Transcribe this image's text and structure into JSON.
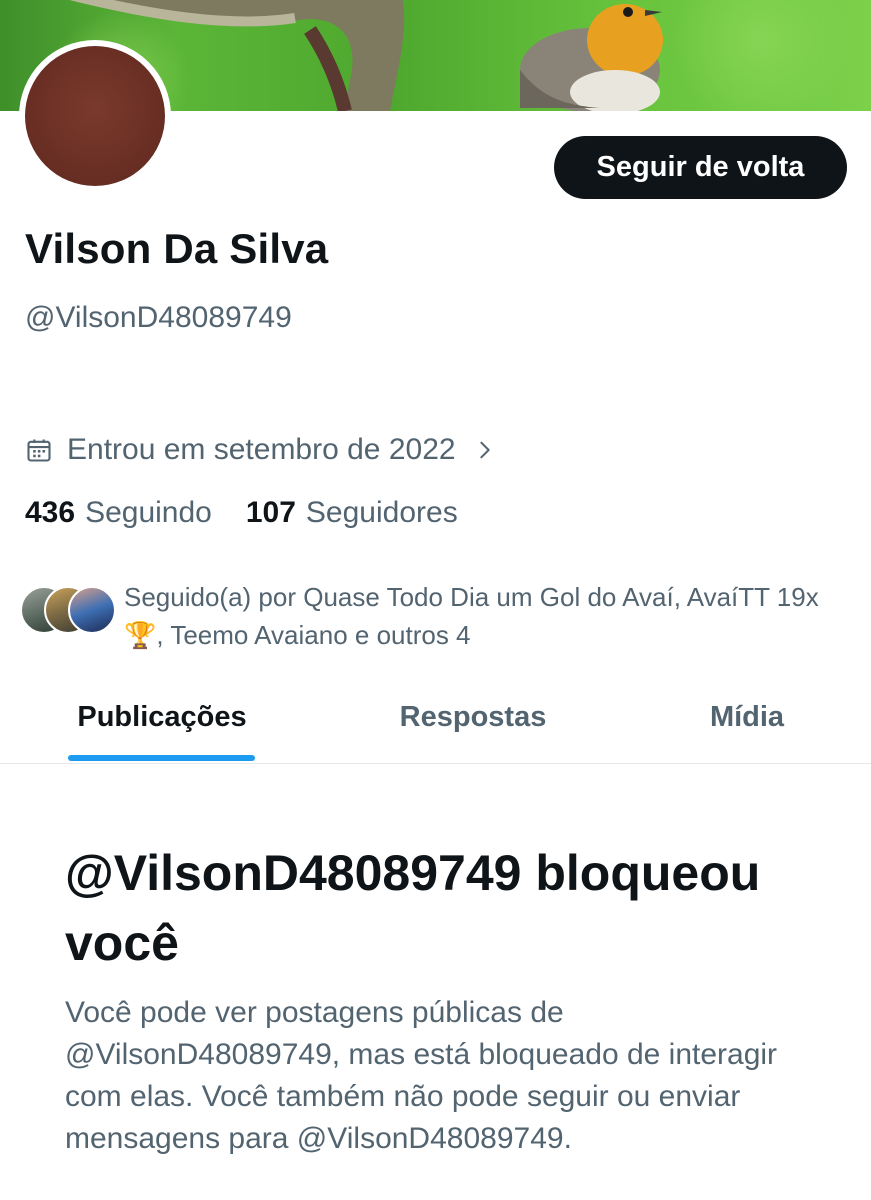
{
  "profile": {
    "display_name": "Vilson Da Silva",
    "handle": "@VilsonD48089749",
    "joined": "Entrou em setembro de 2022",
    "follow_back_label": "Seguir de volta"
  },
  "stats": {
    "following_count": "436",
    "following_label": "Seguindo",
    "followers_count": "107",
    "followers_label": "Seguidores"
  },
  "followed_by": {
    "text": "Seguido(a) por Quase Todo Dia um Gol do Avaí, AvaíTT 19x🏆, Teemo Avaiano e outros 4"
  },
  "tabs": [
    {
      "label": "Publicações",
      "active": true
    },
    {
      "label": "Respostas",
      "active": false
    },
    {
      "label": "Mídia",
      "active": false
    }
  ],
  "blocked": {
    "title": "@VilsonD48089749 bloqueou você",
    "message": "Você pode ver postagens públicas de @VilsonD48089749, mas está bloqueado de interagir com elas. Você também não pode seguir ou enviar mensagens para @VilsonD48089749."
  },
  "colors": {
    "accent": "#1d9bf0",
    "text_primary": "#0f1419",
    "text_secondary": "#536471",
    "button_bg": "#0f1419"
  },
  "icons": {
    "joined": "calendar-icon",
    "joined_arrow": "chevron-right-icon"
  }
}
